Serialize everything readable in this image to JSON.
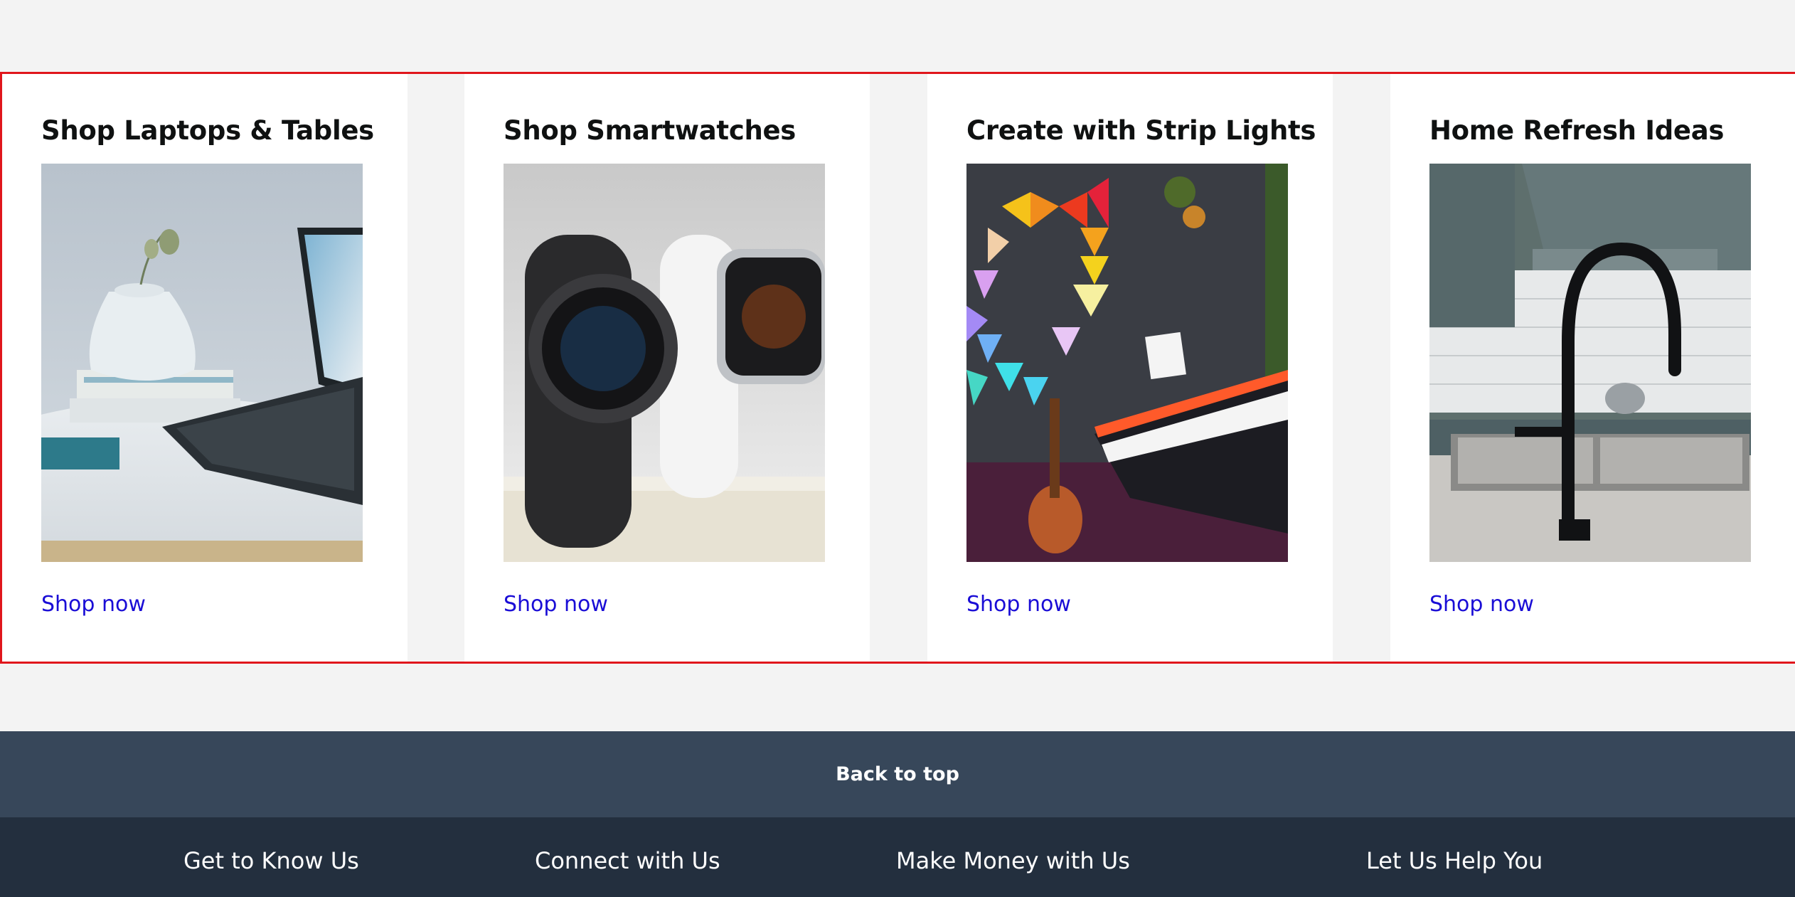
{
  "cards": [
    {
      "title": "Shop Laptops & Tables",
      "link": "Shop now"
    },
    {
      "title": "Shop Smartwatches",
      "link": "Shop now"
    },
    {
      "title": "Create with Strip Lights",
      "link": "Shop now"
    },
    {
      "title": "Home Refresh Ideas",
      "link": "Shop now"
    }
  ],
  "back_to_top": "Back to top",
  "footer": {
    "columns": [
      "Get to Know Us",
      "Connect with Us",
      "Make Money with Us",
      "Let Us Help You"
    ]
  },
  "colors": {
    "page_bg": "#f3f3f3",
    "highlight_border": "#e0161c",
    "link": "#1a0dd6",
    "back_to_top_bg": "#37475a",
    "footer_bg": "#232f3e"
  }
}
